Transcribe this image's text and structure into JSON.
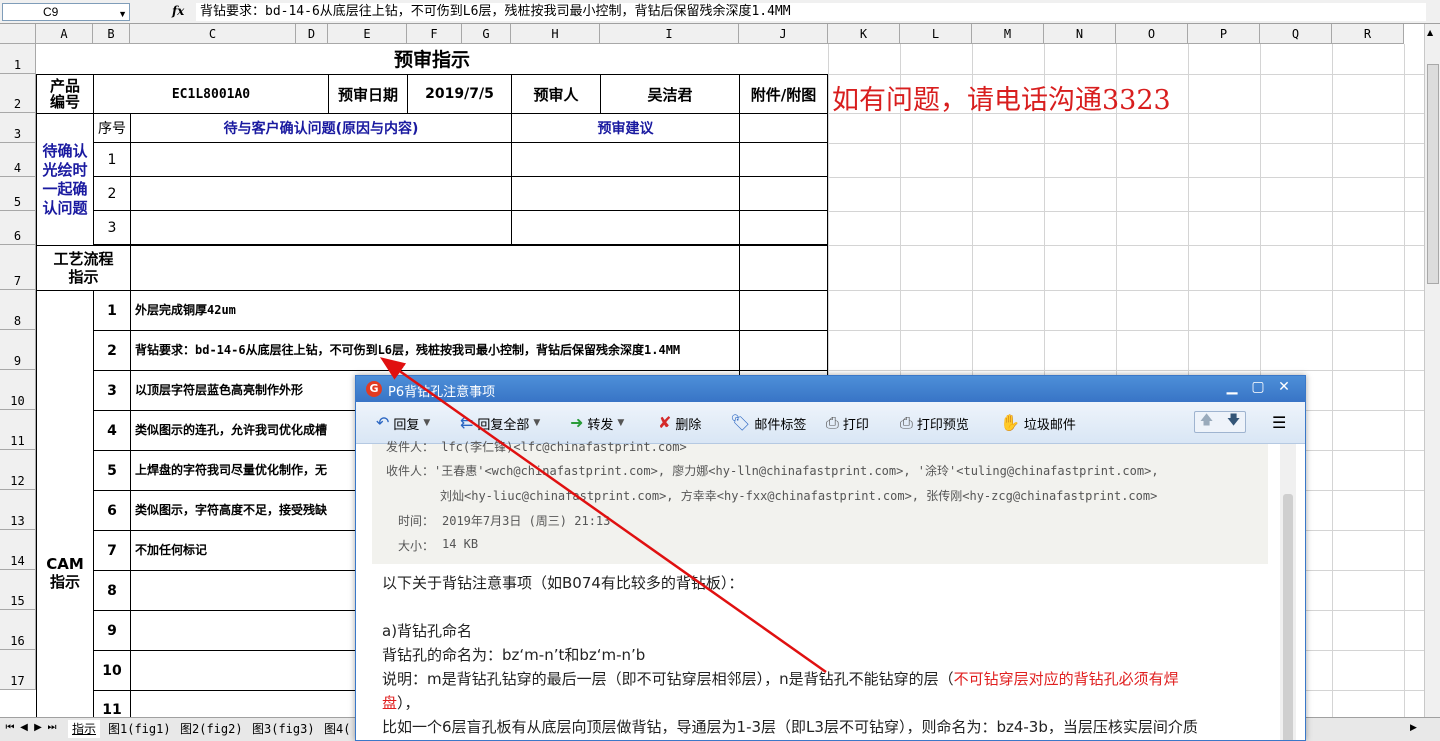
{
  "formula_bar": {
    "cell_ref": "C9",
    "fx": "fx",
    "content": "背钻要求：bd-14-6从底层往上钻，不可伤到L6层，残桩按我司最小控制，背钻后保留残余深度1.4MM"
  },
  "columns": [
    "A",
    "B",
    "C",
    "D",
    "E",
    "F",
    "G",
    "H",
    "I",
    "J",
    "K",
    "L",
    "M",
    "N",
    "O",
    "P",
    "Q",
    "R"
  ],
  "rows": [
    "1",
    "2",
    "3",
    "4",
    "5",
    "6",
    "7",
    "8",
    "9",
    "10",
    "11",
    "12",
    "13",
    "14",
    "15",
    "16",
    "17"
  ],
  "sheet": {
    "title": "预审指示",
    "product_label": "产品编号",
    "product_no": "EC1L8001A0",
    "review_date_label": "预审日期",
    "review_date": "2019/7/5",
    "reviewer_label": "预审人",
    "reviewer": "吴洁君",
    "attachment_label": "附件/附图",
    "note": "如有问题，请电话沟通3323",
    "seq_label": "序号",
    "issues_label": "待与客户确认问题(原因与内容)",
    "suggest_label": "预审建议",
    "pending_label": "待确认光绘时一起确认问题",
    "pending_rows": [
      "1",
      "2",
      "3"
    ],
    "process_label": "工艺流程指示",
    "cam_label": "CAM指示",
    "cam_items": [
      {
        "no": "1",
        "text": "外层完成铜厚42um"
      },
      {
        "no": "2",
        "text": "背钻要求：bd-14-6从底层往上钻，不可伤到L6层，残桩按我司最小控制，背钻后保留残余深度1.4MM"
      },
      {
        "no": "3",
        "text": "以顶层字符层蓝色高亮制作外形"
      },
      {
        "no": "4",
        "text": "类似图示的连孔，允许我司优化成槽"
      },
      {
        "no": "5",
        "text": "上焊盘的字符我司尽量优化制作，无"
      },
      {
        "no": "6",
        "text": "类似图示，字符高度不足，接受残缺"
      },
      {
        "no": "7",
        "text": "不加任何标记"
      },
      {
        "no": "8",
        "text": ""
      },
      {
        "no": "9",
        "text": ""
      },
      {
        "no": "10",
        "text": ""
      },
      {
        "no": "11",
        "text": ""
      }
    ]
  },
  "tabs": [
    "指示",
    "图1(fig1)",
    "图2(fig2)",
    "图3(fig3)",
    "图4("
  ],
  "mail": {
    "title": "P6背钻孔注意事项",
    "toolbar": [
      "回复",
      "回复全部",
      "转发",
      "删除",
      "邮件标签",
      "打印",
      "打印预览",
      "垃圾邮件"
    ],
    "from_line": "发件人：  lfc(李仁锋)<lfc@chinafastprint.com>",
    "to_label": "收件人：",
    "to_line1": "'王春惠'<wch@chinafastprint.com>,   廖力娜<hy-lln@chinafastprint.com>,   '涂玲'<tuling@chinafastprint.com>,",
    "to_line2": "刘灿<hy-liuc@chinafastprint.com>,   方幸幸<hy-fxx@chinafastprint.com>,   张传刚<hy-zcg@chinafastprint.com>",
    "time_label": "时间：",
    "time": "2019年7月3日 (周三) 21:13",
    "size_label": "大小：",
    "size": "14 KB",
    "body": {
      "intro": "以下关于背钻注意事项（如B074有比较多的背钻板）：",
      "section_a": "a)背钻孔命名",
      "naming": "背钻孔的命名为：bz‘m-n’t和bz‘m-n’b",
      "explain": "说明：m是背钻孔钻穿的最后一层（即不可钻穿层相邻层），n是背钻孔不能钻穿的层（",
      "explain_red": "不可钻穿层对应的背钻孔必须有焊",
      "explain_red2": "盘",
      "explain_end": "），",
      "example": "比如一个6层盲孔板有从底层向顶层做背钻，导通层为1-3层（即L3层不可钻穿），则命名为：bz4-3b，当层压核实层间介质"
    }
  }
}
